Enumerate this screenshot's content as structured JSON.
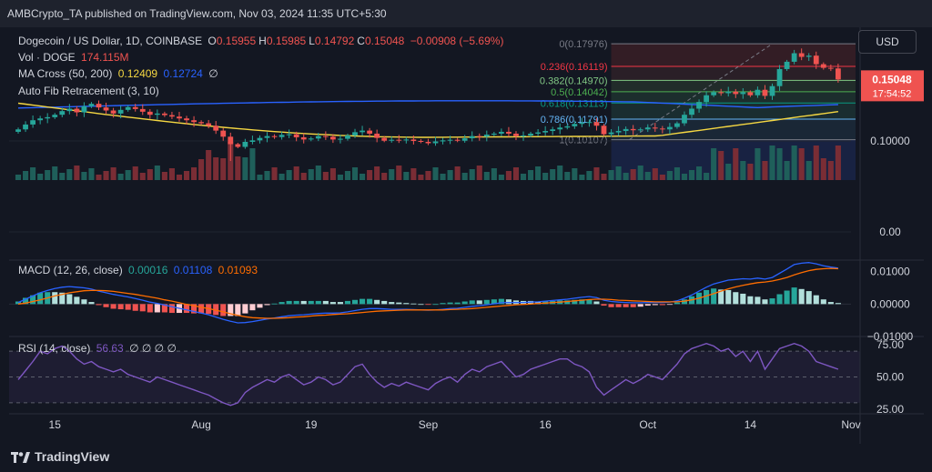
{
  "header": {
    "publisher_line": "AMBCrypto_TA published on TradingView.com, Nov 03, 2024 11:35 UTC+5:30"
  },
  "legend": {
    "symbol": "Dogecoin / US Dollar, 1D, COINBASE",
    "ohlc": [
      {
        "k": "O",
        "v": "0.15955"
      },
      {
        "k": "H",
        "v": "0.15985"
      },
      {
        "k": "L",
        "v": "0.14792"
      },
      {
        "k": "C",
        "v": "0.15048"
      }
    ],
    "change": "−0.00908 (−5.69%)",
    "vol_label": "Vol · DOGE",
    "vol_value": "174.115M",
    "ma_label": "MA Cross (50, 200)",
    "ma_fast": "0.12409",
    "ma_slow": "0.12724",
    "ma_extra": "∅",
    "fib_label": "Auto Fib Retracement (3, 10)",
    "macd_label": "MACD (12, 26, close)",
    "macd_hist": "0.00016",
    "macd_line": "0.01108",
    "macd_signal": "0.01093",
    "rsi_label": "RSI (14, close)",
    "rsi_value": "56.63",
    "rsi_extra": "∅ ∅ ∅ ∅"
  },
  "currency_button": "USD",
  "price_axis": {
    "last_price": "0.15048",
    "countdown": "17:54:52",
    "labels": [
      "0.10000",
      "0.00"
    ]
  },
  "macd_axis": {
    "labels": [
      "0.01000",
      "0.00000",
      "−0.01000"
    ]
  },
  "rsi_axis": {
    "labels": [
      "75.00",
      "50.00",
      "25.00"
    ]
  },
  "time_axis": {
    "labels": [
      "15",
      "Aug",
      "19",
      "Sep",
      "16",
      "Oct",
      "14",
      "Nov"
    ]
  },
  "brand": "TradingView",
  "colors": {
    "background": "#131722",
    "up": "#26a69a",
    "down": "#ef5350",
    "ma_fast": "#f5d742",
    "ma_slow": "#2962ff",
    "macd_line": "#2962ff",
    "macd_signal": "#ff6d00",
    "rsi": "#7e57c2"
  },
  "chart_data": {
    "type": "candlestick",
    "timeframe": "1D",
    "symbol": "DOGEUSD",
    "x_start": "2024-07-10",
    "x_end": "2024-11-03",
    "close": [
      0.1095,
      0.1135,
      0.117,
      0.1185,
      0.1195,
      0.1215,
      0.1245,
      0.1265,
      0.1235,
      0.1285,
      0.1305,
      0.1275,
      0.125,
      0.1225,
      0.1255,
      0.1278,
      0.1262,
      0.124,
      0.1215,
      0.1225,
      0.1212,
      0.12,
      0.1185,
      0.117,
      0.1155,
      0.1145,
      0.1125,
      0.1085,
      0.1035,
      0.0965,
      0.0935,
      0.099,
      0.1005,
      0.1025,
      0.104,
      0.1032,
      0.105,
      0.1055,
      0.103,
      0.1012,
      0.102,
      0.104,
      0.1035,
      0.1012,
      0.1018,
      0.1045,
      0.1072,
      0.1085,
      0.106,
      0.1025,
      0.1002,
      0.101,
      0.1005,
      0.1012,
      0.1,
      0.099,
      0.0975,
      0.0995,
      0.1005,
      0.101,
      0.1002,
      0.1022,
      0.104,
      0.1035,
      0.1052,
      0.106,
      0.1075,
      0.106,
      0.104,
      0.1045,
      0.106,
      0.107,
      0.1082,
      0.1095,
      0.111,
      0.112,
      0.114,
      0.115,
      0.1155,
      0.1125,
      0.1055,
      0.107,
      0.1082,
      0.1098,
      0.1088,
      0.1095,
      0.111,
      0.1102,
      0.1095,
      0.1115,
      0.1145,
      0.1215,
      0.1265,
      0.132,
      0.1375,
      0.14,
      0.1392,
      0.1405,
      0.1385,
      0.14,
      0.1375,
      0.142,
      0.137,
      0.145,
      0.159,
      0.165,
      0.172,
      0.169,
      0.17,
      0.163,
      0.16,
      0.1595,
      0.1505
    ],
    "volume_pattern": "moderate baseline, spikes near early Aug, large spikes in late Oct",
    "ma_fast_start": 0.131,
    "ma_fast_low": 0.103,
    "ma_fast_end": 0.1241,
    "ma_slow_start": 0.127,
    "ma_slow_end": 0.1272,
    "fib_levels": [
      {
        "ratio": "0",
        "price": "0.17976",
        "label": "0(0.17976)",
        "color": "#787b86"
      },
      {
        "ratio": "0.236",
        "price": "0.16119",
        "label": "0.236(0.16119)",
        "color": "#f23645"
      },
      {
        "ratio": "0.382",
        "price": "0.14970",
        "label": "0.382(0.14970)",
        "color": "#81c784"
      },
      {
        "ratio": "0.5",
        "price": "0.14042",
        "label": "0.5(0.14042)",
        "color": "#4caf50"
      },
      {
        "ratio": "0.618",
        "price": "0.13113",
        "label": "0.618(0.13113)",
        "color": "#089981"
      },
      {
        "ratio": "0.786",
        "price": "0.11791",
        "label": "0.786(0.11791)",
        "color": "#64b5f6"
      },
      {
        "ratio": "1",
        "price": "0.10107",
        "label": "1(0.10107)",
        "color": "#787b86"
      }
    ],
    "macd_ylim": [
      -0.01,
      0.013
    ],
    "rsi_ylim": [
      25,
      80
    ],
    "rsi": [
      48,
      55,
      62,
      70,
      68,
      72,
      74,
      70,
      64,
      60,
      62,
      58,
      56,
      54,
      56,
      52,
      50,
      48,
      46,
      50,
      48,
      46,
      44,
      42,
      40,
      38,
      36,
      33,
      30,
      28,
      30,
      38,
      42,
      45,
      48,
      46,
      50,
      52,
      48,
      44,
      46,
      50,
      48,
      44,
      46,
      52,
      58,
      60,
      52,
      46,
      42,
      45,
      43,
      46,
      44,
      42,
      40,
      45,
      48,
      50,
      46,
      52,
      56,
      54,
      58,
      60,
      62,
      56,
      50,
      52,
      56,
      58,
      60,
      62,
      64,
      64,
      60,
      58,
      54,
      42,
      36,
      40,
      44,
      48,
      45,
      48,
      52,
      50,
      48,
      54,
      60,
      68,
      72,
      74,
      76,
      74,
      70,
      72,
      66,
      70,
      62,
      70,
      56,
      64,
      72,
      74,
      76,
      74,
      70,
      62,
      60,
      58,
      56
    ],
    "macd": [
      0.0005,
      0.0015,
      0.0025,
      0.0035,
      0.0042,
      0.0048,
      0.0052,
      0.0054,
      0.0052,
      0.005,
      0.0046,
      0.004,
      0.0035,
      0.003,
      0.0026,
      0.0022,
      0.0017,
      0.0012,
      0.0006,
      0.0002,
      -0.0003,
      -0.0008,
      -0.0013,
      -0.0018,
      -0.0023,
      -0.0028,
      -0.0033,
      -0.004,
      -0.0047,
      -0.0053,
      -0.0058,
      -0.0057,
      -0.0054,
      -0.005,
      -0.0046,
      -0.0043,
      -0.0039,
      -0.0036,
      -0.0034,
      -0.0033,
      -0.0031,
      -0.0029,
      -0.0028,
      -0.0028,
      -0.0027,
      -0.0024,
      -0.002,
      -0.0016,
      -0.0014,
      -0.0014,
      -0.0015,
      -0.0016,
      -0.0016,
      -0.0016,
      -0.0017,
      -0.0018,
      -0.0019,
      -0.0018,
      -0.0016,
      -0.0014,
      -0.0013,
      -0.001,
      -0.0007,
      -0.0005,
      -0.0002,
      0.0001,
      0.0004,
      0.0005,
      0.0005,
      0.0005,
      0.0006,
      0.0007,
      0.0009,
      0.0011,
      0.0013,
      0.0015,
      0.0018,
      0.0021,
      0.0023,
      0.002,
      0.0012,
      0.0008,
      0.0006,
      0.0005,
      0.0004,
      0.0004,
      0.0005,
      0.0005,
      0.0005,
      0.0006,
      0.001,
      0.0018,
      0.0028,
      0.004,
      0.0052,
      0.0062,
      0.0068,
      0.0074,
      0.0076,
      0.0078,
      0.0077,
      0.008,
      0.0077,
      0.0082,
      0.0095,
      0.0108,
      0.0122,
      0.0126,
      0.0128,
      0.0124,
      0.0118,
      0.0114,
      0.0111
    ],
    "macd_signal": [
      0.0,
      0.0003,
      0.0008,
      0.0013,
      0.0019,
      0.0025,
      0.003,
      0.0035,
      0.0038,
      0.0041,
      0.0042,
      0.0042,
      0.0041,
      0.0039,
      0.0036,
      0.0033,
      0.003,
      0.0026,
      0.0022,
      0.0018,
      0.0013,
      0.0009,
      0.0004,
      -0.0001,
      -0.0005,
      -0.001,
      -0.0014,
      -0.0019,
      -0.0024,
      -0.003,
      -0.0035,
      -0.0039,
      -0.0042,
      -0.0043,
      -0.0044,
      -0.0044,
      -0.0043,
      -0.0042,
      -0.004,
      -0.0039,
      -0.0037,
      -0.0035,
      -0.0034,
      -0.0032,
      -0.0031,
      -0.003,
      -0.0028,
      -0.0026,
      -0.0024,
      -0.0022,
      -0.0021,
      -0.002,
      -0.0019,
      -0.0018,
      -0.0018,
      -0.0018,
      -0.0018,
      -0.0018,
      -0.0018,
      -0.0017,
      -0.0016,
      -0.0015,
      -0.0014,
      -0.0012,
      -0.001,
      -0.0008,
      -0.0006,
      -0.0004,
      -0.0002,
      -0.0001,
      0.0,
      0.0002,
      0.0003,
      0.0005,
      0.0006,
      0.0008,
      0.001,
      0.0012,
      0.0014,
      0.0015,
      0.0015,
      0.0014,
      0.0012,
      0.0011,
      0.001,
      0.0009,
      0.0008,
      0.0007,
      0.0007,
      0.0007,
      0.0007,
      0.0009,
      0.0013,
      0.0018,
      0.0025,
      0.0032,
      0.004,
      0.0047,
      0.0053,
      0.0058,
      0.0062,
      0.0066,
      0.0068,
      0.0071,
      0.0076,
      0.0082,
      0.009,
      0.0097,
      0.0103,
      0.0107,
      0.0109,
      0.011,
      0.0109
    ]
  }
}
